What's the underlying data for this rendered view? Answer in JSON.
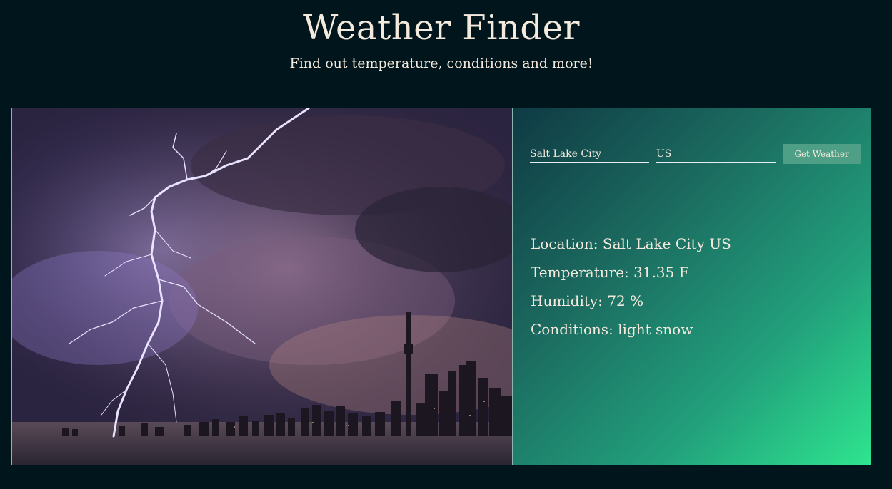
{
  "header": {
    "title": "Weather Finder",
    "subtitle": "Find out temperature, conditions and more!"
  },
  "form": {
    "city_value": "Salt Lake City",
    "country_value": "US",
    "submit_label": "Get Weather"
  },
  "results": {
    "location": "Location: Salt Lake City US",
    "temperature": "Temperature: 31.35 F",
    "humidity": "Humidity: 72 %",
    "conditions": "Conditions: light snow"
  },
  "colors": {
    "background": "#01161c",
    "text": "#f3e9dc",
    "button": "#4e9f86",
    "gradient_start": "#0f3a44",
    "gradient_end": "#2ee58f"
  },
  "image": {
    "subject": "lightning-over-city-skyline"
  }
}
